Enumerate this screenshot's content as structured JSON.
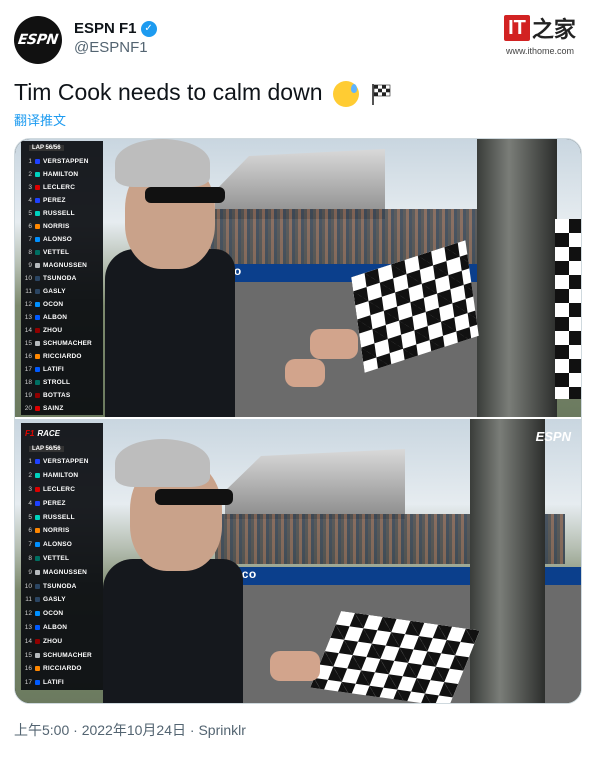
{
  "account": {
    "display_name": "ESPN F1",
    "handle": "@ESPNF1",
    "avatar_text": "ESPN"
  },
  "watermark": {
    "brand": "IT",
    "brand_zh": "之家",
    "url": "www.ithome.com"
  },
  "tweet": {
    "text": "Tim Cook needs to calm down",
    "emojis": [
      "sweat-smile-emoji",
      "checkered-flag-emoji"
    ],
    "translate_label": "翻译推文"
  },
  "media": {
    "top": {
      "board_header": "LAP 56/56",
      "drivers": [
        "VERSTAPPEN",
        "HAMILTON",
        "LECLERC",
        "PEREZ",
        "RUSSELL",
        "NORRIS",
        "ALONSO",
        "VETTEL",
        "MAGNUSSEN",
        "TSUNODA",
        "GASLY",
        "OCON",
        "ALBON",
        "ZHOU",
        "SCHUMACHER",
        "RICCIARDO",
        "LATIFI",
        "STROLL",
        "BOTTAS",
        "SAINZ"
      ],
      "banner": "aramco"
    },
    "bottom": {
      "board_title": "RACE",
      "board_lap": "LAP 56/56",
      "drivers": [
        "VERSTAPPEN",
        "HAMILTON",
        "LECLERC",
        "PEREZ",
        "RUSSELL",
        "NORRIS",
        "ALONSO",
        "VETTEL",
        "MAGNUSSEN",
        "TSUNODA",
        "GASLY",
        "OCON",
        "ALBON",
        "ZHOU",
        "SCHUMACHER",
        "RICCIARDO",
        "LATIFI"
      ],
      "banner": "aramco",
      "broadcast_bug": "ESPN"
    }
  },
  "footer": {
    "time": "上午5:00",
    "date": "2022年10月24日",
    "source": "Sprinklr",
    "separator": "·"
  },
  "colors": {
    "link": "#1d9bf0",
    "muted": "#536471",
    "verified": "#1d9bf0"
  }
}
